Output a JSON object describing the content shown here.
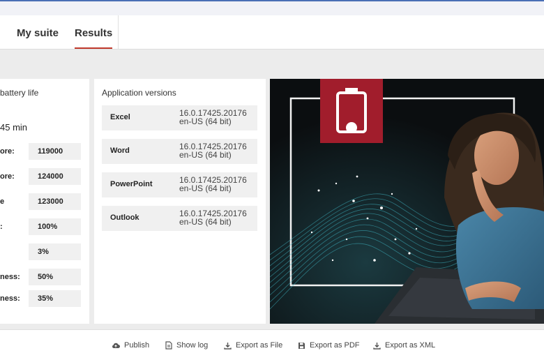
{
  "tabs": {
    "my_suite": "My suite",
    "results": "Results"
  },
  "battery": {
    "heading": "battery life",
    "duration": "45 min",
    "stats": [
      {
        "label": "ore:",
        "value": "119000"
      },
      {
        "label": "ore:",
        "value": "124000"
      },
      {
        "label": "e",
        "value": "123000"
      },
      {
        "label": ":",
        "value": "100%"
      },
      {
        "label": "",
        "value": "3%"
      },
      {
        "label": "ness:",
        "value": "50%"
      },
      {
        "label": "ness:",
        "value": "35%"
      }
    ]
  },
  "versions": {
    "heading": "Application versions",
    "items": [
      {
        "name": "Excel",
        "version": "16.0.17425.20176",
        "locale": "en-US (64 bit)"
      },
      {
        "name": "Word",
        "version": "16.0.17425.20176",
        "locale": "en-US (64 bit)"
      },
      {
        "name": "PowerPoint",
        "version": "16.0.17425.20176",
        "locale": "en-US (64 bit)"
      },
      {
        "name": "Outlook",
        "version": "16.0.17425.20176",
        "locale": "en-US (64 bit)"
      }
    ]
  },
  "hero": {
    "icon": "battery-low-icon",
    "badge_color": "#a11d2c",
    "wave_color": "#3fb8c6"
  },
  "actions": [
    {
      "icon": "cloud-upload-icon",
      "label": "Publish"
    },
    {
      "icon": "document-icon",
      "label": "Show log"
    },
    {
      "icon": "download-icon",
      "label": "Export as File"
    },
    {
      "icon": "save-icon",
      "label": "Export as PDF"
    },
    {
      "icon": "download-icon",
      "label": "Export as XML"
    }
  ]
}
